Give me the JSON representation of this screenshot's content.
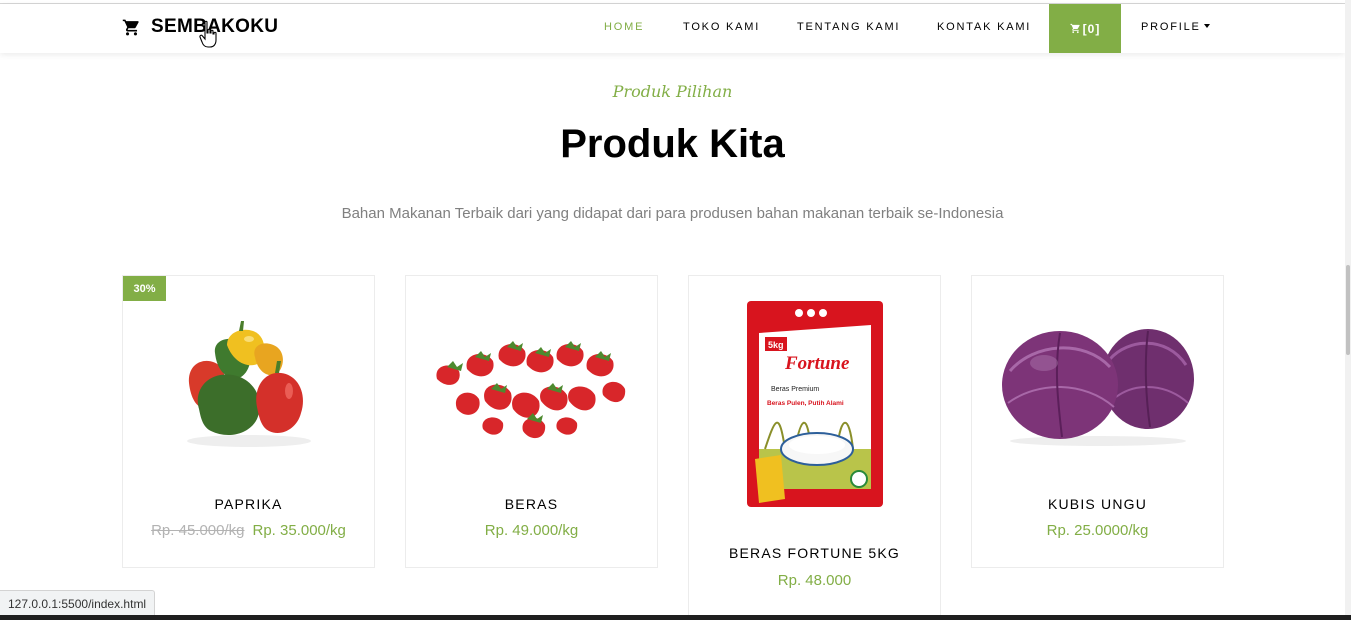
{
  "navbar": {
    "brand": "SEMBAKOKU",
    "links": [
      "HOME",
      "TOKO KAMI",
      "TENTANG KAMI",
      "KONTAK KAMI"
    ],
    "cart_label": "[0]",
    "profile_label": "PROFILE"
  },
  "section": {
    "subheading": "Produk Pilihan",
    "heading": "Produk Kita",
    "lead": "Bahan Makanan Terbaik dari yang didapat dari para produsen bahan makanan terbaik se-Indonesia"
  },
  "products": [
    {
      "name": "PAPRIKA",
      "badge": "30%",
      "old_price": "Rp. 45.000/kg",
      "price": "Rp. 35.000/kg",
      "image": "paprika-image"
    },
    {
      "name": "BERAS",
      "price": "Rp. 49.000/kg",
      "image": "strawberry-image"
    },
    {
      "name": "BERAS FORTUNE 5KG",
      "price": "Rp. 48.000",
      "image": "rice-bag-image",
      "package_text": {
        "brand": "Fortune",
        "weight": "5kg",
        "line1": "Beras Premium",
        "line2": "Beras Pulen, Putih Alami"
      }
    },
    {
      "name": "KUBIS UNGU",
      "price": "Rp. 25.0000/kg",
      "image": "red-cabbage-image"
    }
  ],
  "status_bar": {
    "url": "127.0.0.1:5500/index.html"
  },
  "colors": {
    "accent": "#82ae46",
    "muted": "#808080",
    "strike": "#b3b3b3"
  }
}
